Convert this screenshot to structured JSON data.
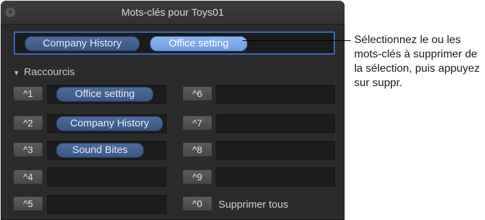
{
  "window": {
    "title": "Mots-clés pour Toys01",
    "close_icon": "close-icon"
  },
  "keyword_field": {
    "tokens": [
      {
        "label": "Company History",
        "selected": false
      },
      {
        "label": "Office setting",
        "selected": true
      }
    ]
  },
  "shortcuts": {
    "header": "Raccourcis",
    "rows": [
      {
        "key": "^1",
        "keyword": "Office setting"
      },
      {
        "key": "^2",
        "keyword": "Company History"
      },
      {
        "key": "^3",
        "keyword": "Sound Bites"
      },
      {
        "key": "^4",
        "keyword": ""
      },
      {
        "key": "^5",
        "keyword": ""
      },
      {
        "key": "^6",
        "keyword": ""
      },
      {
        "key": "^7",
        "keyword": ""
      },
      {
        "key": "^8",
        "keyword": ""
      },
      {
        "key": "^9",
        "keyword": ""
      },
      {
        "key": "^0",
        "keyword": ""
      }
    ],
    "clear_all_label": "Supprimer tous"
  },
  "callout": {
    "text": "Sélectionnez le ou les mots-clés à supprimer de la sélection, puis appuyez sur suppr."
  },
  "colors": {
    "panel_bg": "#2b2b2b",
    "field_border": "#3b6fc4",
    "token_bg": "#3a5784",
    "token_selected_bg": "#7ea9e6"
  }
}
